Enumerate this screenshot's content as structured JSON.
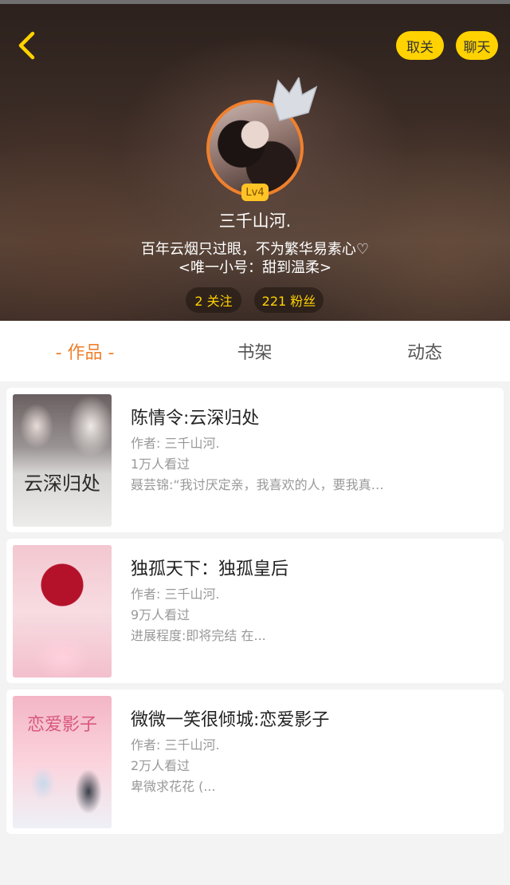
{
  "header": {
    "unfollow_label": "取关",
    "chat_label": "聊天",
    "level": "Lv4",
    "username": "三千山河.",
    "bio_line1": "百年云烟只过眼，不为繁华易素心♡",
    "bio_line2": "<唯一小号：甜到温柔>",
    "following": "2 关注",
    "fans": "221 粉丝"
  },
  "tabs": [
    {
      "label": "- 作品 -",
      "active": true
    },
    {
      "label": "书架",
      "active": false
    },
    {
      "label": "动态",
      "active": false
    }
  ],
  "works": [
    {
      "title": "陈情令:云深归处",
      "author": "作者: 三千山河.",
      "views": "1万人看过",
      "desc": "聂芸锦:“我讨厌定亲，我喜欢的人，要我真…",
      "cover_text": "云深归处"
    },
    {
      "title": "独孤天下：独孤皇后",
      "author": "作者: 三千山河.",
      "views": "9万人看过",
      "desc": "进展程度:即将完结 在...",
      "cover_text": ""
    },
    {
      "title": "微微一笑很倾城:恋爱影子",
      "author": "作者: 三千山河.",
      "views": "2万人看过",
      "desc": "卑微求花花 (...",
      "cover_text": "恋爱影子"
    }
  ],
  "colors": {
    "accent": "#f0802d",
    "button_yellow": "#ffd200",
    "level_badge": "#ffc425"
  }
}
